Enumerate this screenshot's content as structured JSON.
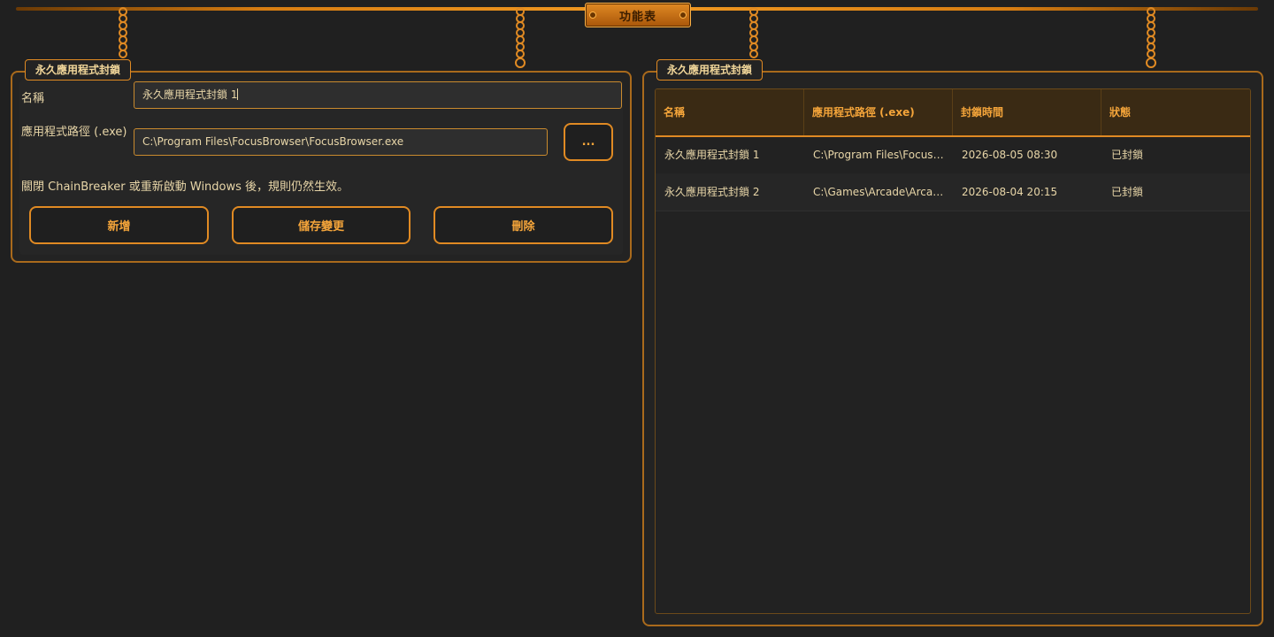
{
  "menu": {
    "title": "功能表"
  },
  "left_panel": {
    "tab_label": "永久應用程式封鎖",
    "name_label": "名稱",
    "name_value": "永久應用程式封鎖 1",
    "path_label": "應用程式路徑 (.exe)",
    "path_value": "C:\\Program Files\\FocusBrowser\\FocusBrowser.exe",
    "browse_label": "...",
    "note": "關閉 ChainBreaker 或重新啟動 Windows 後，規則仍然生效。",
    "buttons": {
      "add": "新增",
      "save": "儲存變更",
      "delete": "刪除"
    }
  },
  "right_panel": {
    "tab_label": "永久應用程式封鎖",
    "columns": [
      "名稱",
      "應用程式路徑 (.exe)",
      "封鎖時間",
      "狀態"
    ],
    "rows": [
      [
        "永久應用程式封鎖 1",
        "C:\\Program Files\\FocusBrowser\\FocusBrowser.exe",
        "2026-08-05 08:30",
        "已封鎖"
      ],
      [
        "永久應用程式封鎖 2",
        "C:\\Games\\Arcade\\Arcade.exe",
        "2026-08-04 20:15",
        "已封鎖"
      ]
    ]
  },
  "colors": {
    "accent": "#e08a23",
    "text": "#e8d6a8",
    "background": "#202020"
  }
}
